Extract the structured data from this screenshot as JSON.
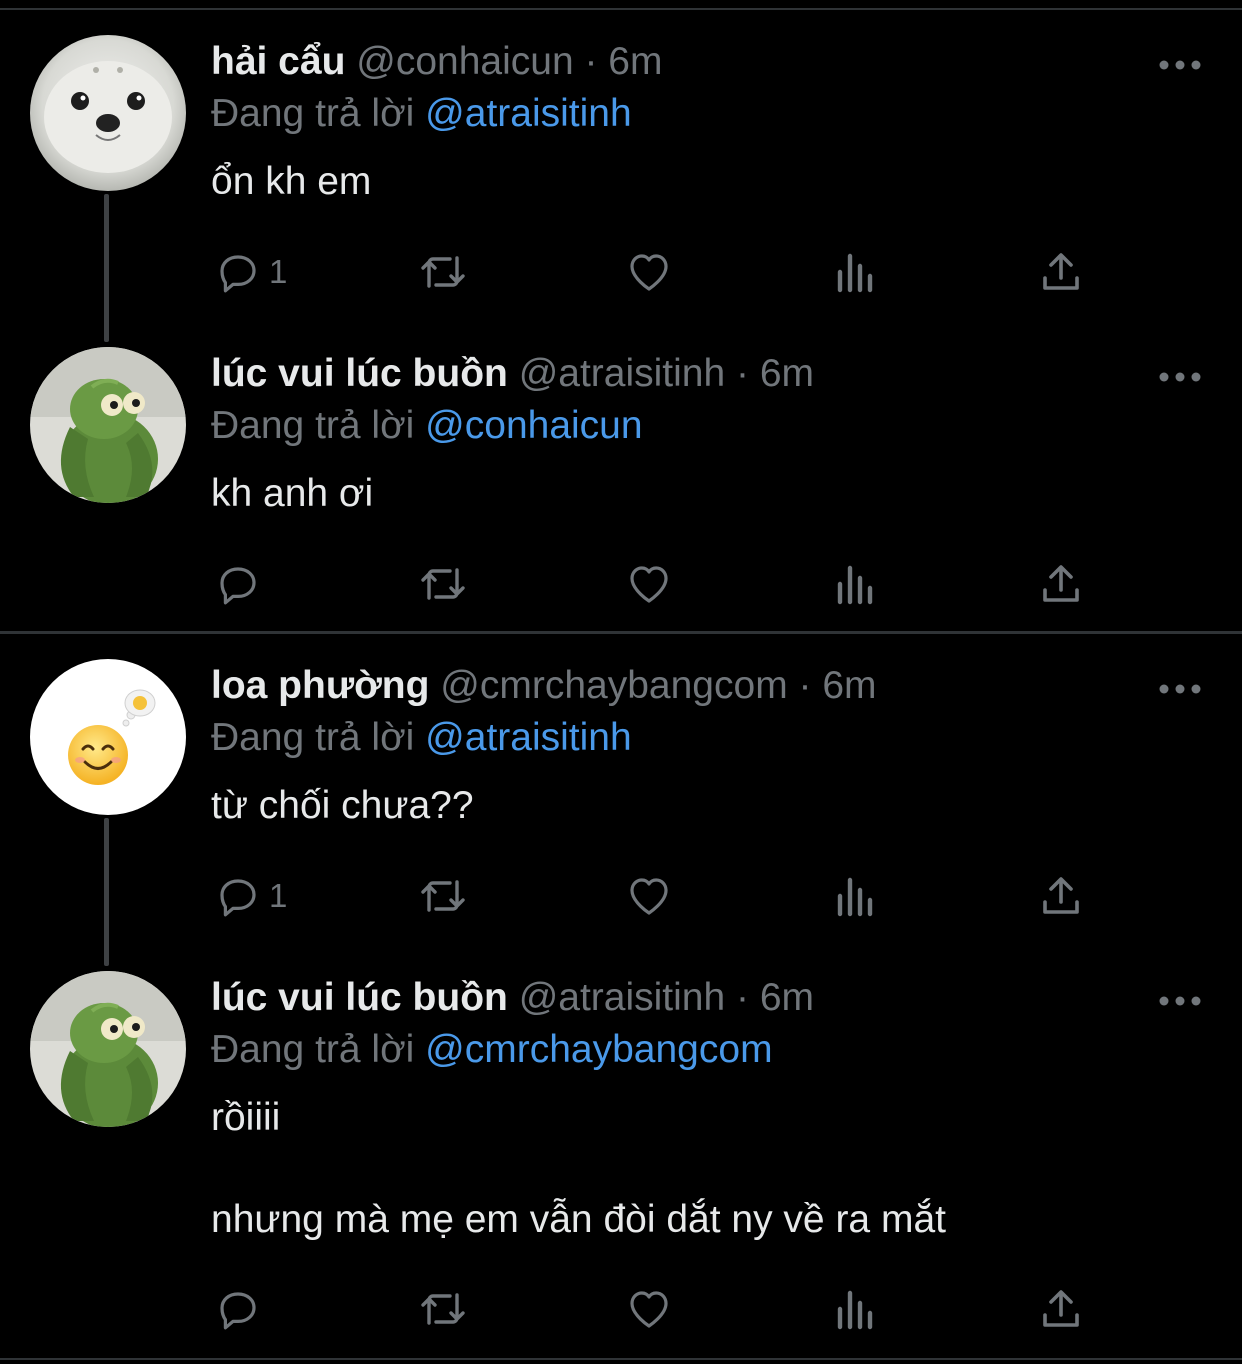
{
  "tweets": [
    {
      "name": "hải cẩu",
      "handle": "@conhaicun",
      "time": "· 6m",
      "replying_prefix": "Đang trả lời",
      "replying_to": "@atraisitinh",
      "text": [
        "ổn kh em"
      ],
      "reply_count": "1",
      "avatar_icon": "seal-avatar-icon"
    },
    {
      "name": "lúc vui lúc buồn",
      "handle": "@atraisitinh",
      "time": "· 6m",
      "replying_prefix": "Đang trả lời",
      "replying_to": "@conhaicun",
      "text": [
        "kh anh ơi"
      ],
      "reply_count": "",
      "avatar_icon": "green-plush-avatar-icon"
    },
    {
      "name": "loa phường",
      "handle": "@cmrchaybangcom",
      "time": "· 6m",
      "replying_prefix": "Đang trả lời",
      "replying_to": "@atraisitinh",
      "text": [
        "từ chối chưa??"
      ],
      "reply_count": "1",
      "avatar_icon": "smiley-avatar-icon"
    },
    {
      "name": "lúc vui lúc buồn",
      "handle": "@atraisitinh",
      "time": "· 6m",
      "replying_prefix": "Đang trả lời",
      "replying_to": "@cmrchaybangcom",
      "text": [
        "rồiiii",
        "nhưng mà mẹ em vẫn đòi dắt ny về ra mắt"
      ],
      "reply_count": "",
      "avatar_icon": "green-plush-avatar-icon"
    }
  ],
  "theme": {
    "background": "#000000",
    "text_primary": "#e7e9ea",
    "text_secondary": "#71767b",
    "mention": "#4a99e9",
    "divider": "#2f3336"
  }
}
